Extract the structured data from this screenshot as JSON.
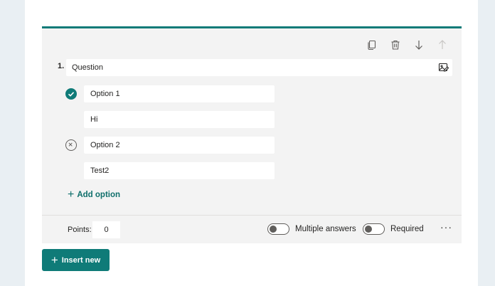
{
  "question": {
    "number": "1.",
    "title": "Question"
  },
  "toolbar": {
    "copy_icon": "copy-icon",
    "delete_icon": "trash-icon",
    "move_down_icon": "arrow-down-icon",
    "move_up_icon": "arrow-up-icon"
  },
  "options": [
    {
      "text": "Option 1",
      "feedback": "Hi",
      "correct": true
    },
    {
      "text": "Option 2",
      "feedback": "Test2",
      "correct": false
    }
  ],
  "add_option_label": "Add option",
  "footer": {
    "points_label": "Points:",
    "points_value": "0",
    "multiple_answers_label": "Multiple answers",
    "multiple_answers_on": false,
    "required_label": "Required",
    "required_on": false,
    "more_label": "···"
  },
  "insert_new_label": "Insert new",
  "colors": {
    "accent": "#0f7b78",
    "card_bg": "#f3f3f3",
    "page_bg": "#e9eff3"
  }
}
